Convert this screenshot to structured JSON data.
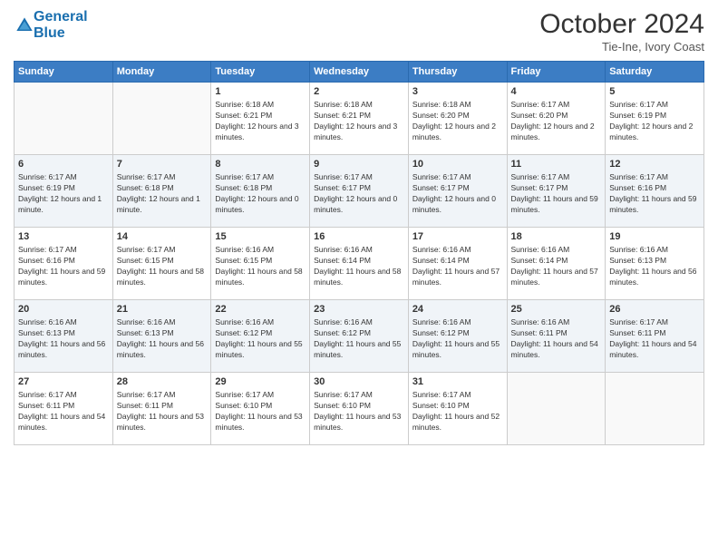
{
  "logo": {
    "line1": "General",
    "line2": "Blue"
  },
  "title": "October 2024",
  "subtitle": "Tie-Ine, Ivory Coast",
  "days_of_week": [
    "Sunday",
    "Monday",
    "Tuesday",
    "Wednesday",
    "Thursday",
    "Friday",
    "Saturday"
  ],
  "weeks": [
    [
      {
        "day": "",
        "info": ""
      },
      {
        "day": "",
        "info": ""
      },
      {
        "day": "1",
        "info": "Sunrise: 6:18 AM\nSunset: 6:21 PM\nDaylight: 12 hours and 3 minutes."
      },
      {
        "day": "2",
        "info": "Sunrise: 6:18 AM\nSunset: 6:21 PM\nDaylight: 12 hours and 3 minutes."
      },
      {
        "day": "3",
        "info": "Sunrise: 6:18 AM\nSunset: 6:20 PM\nDaylight: 12 hours and 2 minutes."
      },
      {
        "day": "4",
        "info": "Sunrise: 6:17 AM\nSunset: 6:20 PM\nDaylight: 12 hours and 2 minutes."
      },
      {
        "day": "5",
        "info": "Sunrise: 6:17 AM\nSunset: 6:19 PM\nDaylight: 12 hours and 2 minutes."
      }
    ],
    [
      {
        "day": "6",
        "info": "Sunrise: 6:17 AM\nSunset: 6:19 PM\nDaylight: 12 hours and 1 minute."
      },
      {
        "day": "7",
        "info": "Sunrise: 6:17 AM\nSunset: 6:18 PM\nDaylight: 12 hours and 1 minute."
      },
      {
        "day": "8",
        "info": "Sunrise: 6:17 AM\nSunset: 6:18 PM\nDaylight: 12 hours and 0 minutes."
      },
      {
        "day": "9",
        "info": "Sunrise: 6:17 AM\nSunset: 6:17 PM\nDaylight: 12 hours and 0 minutes."
      },
      {
        "day": "10",
        "info": "Sunrise: 6:17 AM\nSunset: 6:17 PM\nDaylight: 12 hours and 0 minutes."
      },
      {
        "day": "11",
        "info": "Sunrise: 6:17 AM\nSunset: 6:17 PM\nDaylight: 11 hours and 59 minutes."
      },
      {
        "day": "12",
        "info": "Sunrise: 6:17 AM\nSunset: 6:16 PM\nDaylight: 11 hours and 59 minutes."
      }
    ],
    [
      {
        "day": "13",
        "info": "Sunrise: 6:17 AM\nSunset: 6:16 PM\nDaylight: 11 hours and 59 minutes."
      },
      {
        "day": "14",
        "info": "Sunrise: 6:17 AM\nSunset: 6:15 PM\nDaylight: 11 hours and 58 minutes."
      },
      {
        "day": "15",
        "info": "Sunrise: 6:16 AM\nSunset: 6:15 PM\nDaylight: 11 hours and 58 minutes."
      },
      {
        "day": "16",
        "info": "Sunrise: 6:16 AM\nSunset: 6:14 PM\nDaylight: 11 hours and 58 minutes."
      },
      {
        "day": "17",
        "info": "Sunrise: 6:16 AM\nSunset: 6:14 PM\nDaylight: 11 hours and 57 minutes."
      },
      {
        "day": "18",
        "info": "Sunrise: 6:16 AM\nSunset: 6:14 PM\nDaylight: 11 hours and 57 minutes."
      },
      {
        "day": "19",
        "info": "Sunrise: 6:16 AM\nSunset: 6:13 PM\nDaylight: 11 hours and 56 minutes."
      }
    ],
    [
      {
        "day": "20",
        "info": "Sunrise: 6:16 AM\nSunset: 6:13 PM\nDaylight: 11 hours and 56 minutes."
      },
      {
        "day": "21",
        "info": "Sunrise: 6:16 AM\nSunset: 6:13 PM\nDaylight: 11 hours and 56 minutes."
      },
      {
        "day": "22",
        "info": "Sunrise: 6:16 AM\nSunset: 6:12 PM\nDaylight: 11 hours and 55 minutes."
      },
      {
        "day": "23",
        "info": "Sunrise: 6:16 AM\nSunset: 6:12 PM\nDaylight: 11 hours and 55 minutes."
      },
      {
        "day": "24",
        "info": "Sunrise: 6:16 AM\nSunset: 6:12 PM\nDaylight: 11 hours and 55 minutes."
      },
      {
        "day": "25",
        "info": "Sunrise: 6:16 AM\nSunset: 6:11 PM\nDaylight: 11 hours and 54 minutes."
      },
      {
        "day": "26",
        "info": "Sunrise: 6:17 AM\nSunset: 6:11 PM\nDaylight: 11 hours and 54 minutes."
      }
    ],
    [
      {
        "day": "27",
        "info": "Sunrise: 6:17 AM\nSunset: 6:11 PM\nDaylight: 11 hours and 54 minutes."
      },
      {
        "day": "28",
        "info": "Sunrise: 6:17 AM\nSunset: 6:11 PM\nDaylight: 11 hours and 53 minutes."
      },
      {
        "day": "29",
        "info": "Sunrise: 6:17 AM\nSunset: 6:10 PM\nDaylight: 11 hours and 53 minutes."
      },
      {
        "day": "30",
        "info": "Sunrise: 6:17 AM\nSunset: 6:10 PM\nDaylight: 11 hours and 53 minutes."
      },
      {
        "day": "31",
        "info": "Sunrise: 6:17 AM\nSunset: 6:10 PM\nDaylight: 11 hours and 52 minutes."
      },
      {
        "day": "",
        "info": ""
      },
      {
        "day": "",
        "info": ""
      }
    ]
  ]
}
